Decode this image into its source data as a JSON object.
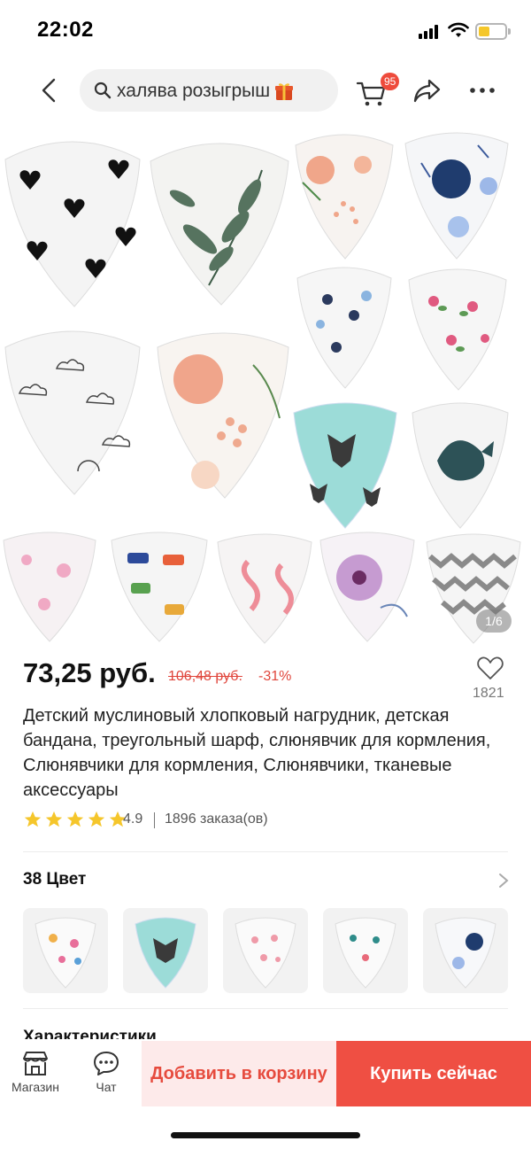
{
  "status_bar": {
    "time": "22:02"
  },
  "search": {
    "query": "халява розыгрыш"
  },
  "cart": {
    "badge_count": "95"
  },
  "gallery": {
    "counter": "1/6"
  },
  "product": {
    "price": "73,25 руб.",
    "old_price": "106,48 руб.",
    "discount": "-31%",
    "wishlist_count": "1821",
    "title": "Детский муслиновый хлопковый нагрудник, детская бандана, треугольный шарф, слюнявчик для кормления, Слюнявчики для кормления, Слюнявчики, тканевые аксессуары",
    "rating": "4.9",
    "stars": 5,
    "orders": "1896 заказа(ов)"
  },
  "colors": {
    "label": "38 Цвет"
  },
  "specs": {
    "label": "Характеристики"
  },
  "bottom_bar": {
    "store_label": "Магазин",
    "chat_label": "Чат",
    "add_to_cart": "Добавить в корзину",
    "buy_now": "Купить сейчас"
  },
  "colors_palette": {
    "accent": "#ef4f43",
    "accent_light": "#fdeaea",
    "star": "#f5c62b",
    "badge": "#ee4b3c"
  }
}
